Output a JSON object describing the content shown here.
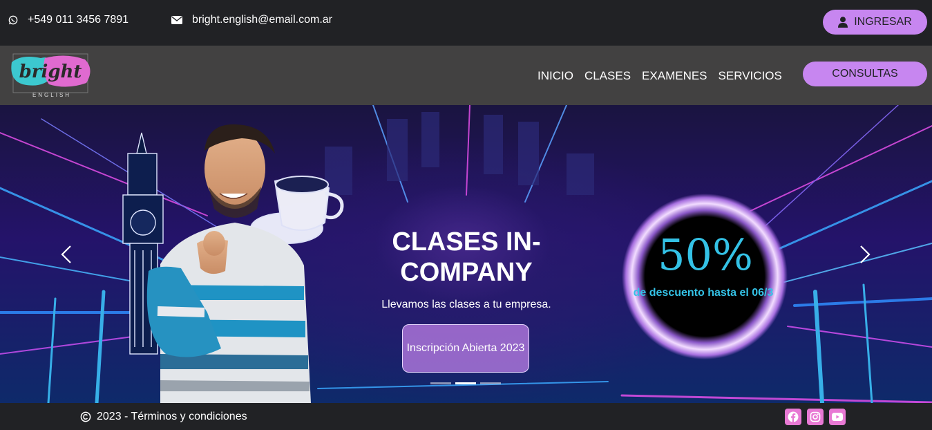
{
  "topbar": {
    "phone_icon": "whatsapp-icon",
    "phone": "+549 011 3456 7891",
    "email_icon": "envelope-icon",
    "email": "bright.english@email.com.ar",
    "login_icon": "user-icon",
    "login_label": "INGRESAR"
  },
  "navbar": {
    "logo_text": "bright",
    "logo_sub": "ENGLISH",
    "items": [
      {
        "label": "INICIO"
      },
      {
        "label": "CLASES"
      },
      {
        "label": "EXAMENES"
      },
      {
        "label": "SERVICIOS"
      }
    ],
    "cta_label": "CONSULTAS"
  },
  "hero": {
    "title": "CLASES IN-COMPANY",
    "subtitle": "Llevamos las clases a tu empresa.",
    "button_label": "Inscripción Abierta 2023",
    "badge_percent": "50%",
    "badge_text": "de descuento hasta el 06/3",
    "slides": 3,
    "active_slide": 2
  },
  "footer": {
    "copyright_icon": "copyright-icon",
    "text": "2023 - Términos y condiciones",
    "socials": [
      "facebook-icon",
      "instagram-icon",
      "youtube-icon"
    ]
  },
  "colors": {
    "accent": "#c786f0",
    "dark": "#212225",
    "navbar": "#424141",
    "badge_text": "#34c2e6",
    "social": "#e879d4"
  }
}
